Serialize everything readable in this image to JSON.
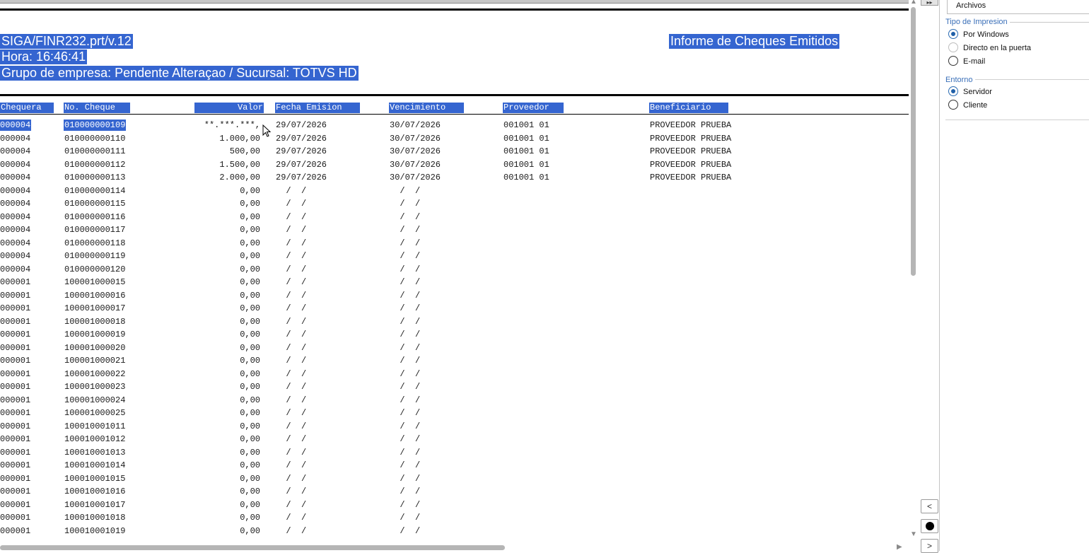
{
  "report": {
    "program": "SIGA/FINR232.prt/v.12",
    "hour": "Hora: 16:46:41",
    "company": "Grupo de empresa: Pendente Alteraçao / Sucursal: TOTVS HD",
    "title": "Informe de Cheques Emitidos",
    "columns": {
      "chequera": "Chequera",
      "no_cheque": "No. Cheque",
      "valor": "Valor",
      "fecha_emision": "Fecha Emision",
      "vencimiento": "Vencimiento",
      "proveedor": "Proveedor",
      "beneficiario": "Beneficiario"
    },
    "rows": [
      {
        "chequera": "000004",
        "no_cheque": "010000000109",
        "valor": "**.***.***,",
        "fecha": "29/07/2026",
        "venc": "30/07/2026",
        "proveedor": "001001 01",
        "beneficiario": "PROVEEDOR PRUEBA"
      },
      {
        "chequera": "000004",
        "no_cheque": "010000000110",
        "valor": "1.000,00",
        "fecha": "29/07/2026",
        "venc": "30/07/2026",
        "proveedor": "001001 01",
        "beneficiario": "PROVEEDOR PRUEBA"
      },
      {
        "chequera": "000004",
        "no_cheque": "010000000111",
        "valor": "500,00",
        "fecha": "29/07/2026",
        "venc": "30/07/2026",
        "proveedor": "001001 01",
        "beneficiario": "PROVEEDOR PRUEBA"
      },
      {
        "chequera": "000004",
        "no_cheque": "010000000112",
        "valor": "1.500,00",
        "fecha": "29/07/2026",
        "venc": "30/07/2026",
        "proveedor": "001001 01",
        "beneficiario": "PROVEEDOR PRUEBA"
      },
      {
        "chequera": "000004",
        "no_cheque": "010000000113",
        "valor": "2.000,00",
        "fecha": "29/07/2026",
        "venc": "30/07/2026",
        "proveedor": "001001 01",
        "beneficiario": "PROVEEDOR PRUEBA"
      },
      {
        "chequera": "000004",
        "no_cheque": "010000000114",
        "valor": "0,00",
        "fecha": "  /  /",
        "venc": "  /  /",
        "proveedor": "",
        "beneficiario": ""
      },
      {
        "chequera": "000004",
        "no_cheque": "010000000115",
        "valor": "0,00",
        "fecha": "  /  /",
        "venc": "  /  /",
        "proveedor": "",
        "beneficiario": ""
      },
      {
        "chequera": "000004",
        "no_cheque": "010000000116",
        "valor": "0,00",
        "fecha": "  /  /",
        "venc": "  /  /",
        "proveedor": "",
        "beneficiario": ""
      },
      {
        "chequera": "000004",
        "no_cheque": "010000000117",
        "valor": "0,00",
        "fecha": "  /  /",
        "venc": "  /  /",
        "proveedor": "",
        "beneficiario": ""
      },
      {
        "chequera": "000004",
        "no_cheque": "010000000118",
        "valor": "0,00",
        "fecha": "  /  /",
        "venc": "  /  /",
        "proveedor": "",
        "beneficiario": ""
      },
      {
        "chequera": "000004",
        "no_cheque": "010000000119",
        "valor": "0,00",
        "fecha": "  /  /",
        "venc": "  /  /",
        "proveedor": "",
        "beneficiario": ""
      },
      {
        "chequera": "000004",
        "no_cheque": "010000000120",
        "valor": "0,00",
        "fecha": "  /  /",
        "venc": "  /  /",
        "proveedor": "",
        "beneficiario": ""
      },
      {
        "chequera": "000001",
        "no_cheque": "100001000015",
        "valor": "0,00",
        "fecha": "  /  /",
        "venc": "  /  /",
        "proveedor": "",
        "beneficiario": ""
      },
      {
        "chequera": "000001",
        "no_cheque": "100001000016",
        "valor": "0,00",
        "fecha": "  /  /",
        "venc": "  /  /",
        "proveedor": "",
        "beneficiario": ""
      },
      {
        "chequera": "000001",
        "no_cheque": "100001000017",
        "valor": "0,00",
        "fecha": "  /  /",
        "venc": "  /  /",
        "proveedor": "",
        "beneficiario": ""
      },
      {
        "chequera": "000001",
        "no_cheque": "100001000018",
        "valor": "0,00",
        "fecha": "  /  /",
        "venc": "  /  /",
        "proveedor": "",
        "beneficiario": ""
      },
      {
        "chequera": "000001",
        "no_cheque": "100001000019",
        "valor": "0,00",
        "fecha": "  /  /",
        "venc": "  /  /",
        "proveedor": "",
        "beneficiario": ""
      },
      {
        "chequera": "000001",
        "no_cheque": "100001000020",
        "valor": "0,00",
        "fecha": "  /  /",
        "venc": "  /  /",
        "proveedor": "",
        "beneficiario": ""
      },
      {
        "chequera": "000001",
        "no_cheque": "100001000021",
        "valor": "0,00",
        "fecha": "  /  /",
        "venc": "  /  /",
        "proveedor": "",
        "beneficiario": ""
      },
      {
        "chequera": "000001",
        "no_cheque": "100001000022",
        "valor": "0,00",
        "fecha": "  /  /",
        "venc": "  /  /",
        "proveedor": "",
        "beneficiario": ""
      },
      {
        "chequera": "000001",
        "no_cheque": "100001000023",
        "valor": "0,00",
        "fecha": "  /  /",
        "venc": "  /  /",
        "proveedor": "",
        "beneficiario": ""
      },
      {
        "chequera": "000001",
        "no_cheque": "100001000024",
        "valor": "0,00",
        "fecha": "  /  /",
        "venc": "  /  /",
        "proveedor": "",
        "beneficiario": ""
      },
      {
        "chequera": "000001",
        "no_cheque": "100001000025",
        "valor": "0,00",
        "fecha": "  /  /",
        "venc": "  /  /",
        "proveedor": "",
        "beneficiario": ""
      },
      {
        "chequera": "000001",
        "no_cheque": "100010001011",
        "valor": "0,00",
        "fecha": "  /  /",
        "venc": "  /  /",
        "proveedor": "",
        "beneficiario": ""
      },
      {
        "chequera": "000001",
        "no_cheque": "100010001012",
        "valor": "0,00",
        "fecha": "  /  /",
        "venc": "  /  /",
        "proveedor": "",
        "beneficiario": ""
      },
      {
        "chequera": "000001",
        "no_cheque": "100010001013",
        "valor": "0,00",
        "fecha": "  /  /",
        "venc": "  /  /",
        "proveedor": "",
        "beneficiario": ""
      },
      {
        "chequera": "000001",
        "no_cheque": "100010001014",
        "valor": "0,00",
        "fecha": "  /  /",
        "venc": "  /  /",
        "proveedor": "",
        "beneficiario": ""
      },
      {
        "chequera": "000001",
        "no_cheque": "100010001015",
        "valor": "0,00",
        "fecha": "  /  /",
        "venc": "  /  /",
        "proveedor": "",
        "beneficiario": ""
      },
      {
        "chequera": "000001",
        "no_cheque": "100010001016",
        "valor": "0,00",
        "fecha": "  /  /",
        "venc": "  /  /",
        "proveedor": "",
        "beneficiario": ""
      },
      {
        "chequera": "000001",
        "no_cheque": "100010001017",
        "valor": "0,00",
        "fecha": "  /  /",
        "venc": "  /  /",
        "proveedor": "",
        "beneficiario": ""
      },
      {
        "chequera": "000001",
        "no_cheque": "100010001018",
        "valor": "0,00",
        "fecha": "  /  /",
        "venc": "  /  /",
        "proveedor": "",
        "beneficiario": ""
      },
      {
        "chequera": "000001",
        "no_cheque": "100010001019",
        "valor": "0,00",
        "fecha": "  /  /",
        "venc": "  /  /",
        "proveedor": "",
        "beneficiario": ""
      }
    ]
  },
  "panel": {
    "archivos": "Archivos",
    "tipo_impresion": {
      "legend": "Tipo de Impresion",
      "options": [
        "Por Windows",
        "Directo en la puerta",
        "E-mail"
      ],
      "selected": "Por Windows"
    },
    "entorno": {
      "legend": "Entorno",
      "options": [
        "Servidor",
        "Cliente"
      ],
      "selected": "Servidor"
    }
  },
  "nav": {
    "prev": "<",
    "next": ">",
    "collapse": "▸▸"
  },
  "colors": {
    "selection": "#3565d0",
    "accent": "#1f5fa8",
    "legend": "#3a6fb8"
  }
}
